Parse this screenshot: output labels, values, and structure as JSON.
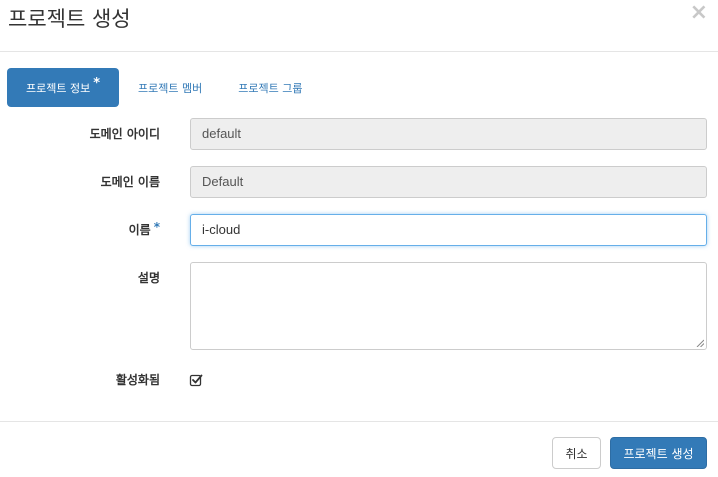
{
  "header": {
    "title": "프로젝트 생성",
    "close_glyph": "×"
  },
  "tabs": [
    {
      "label": "프로젝트 정보",
      "required_mark": "*",
      "active": true
    },
    {
      "label": "프로젝트 멤버",
      "active": false
    },
    {
      "label": "프로젝트 그룹",
      "active": false
    }
  ],
  "form": {
    "domain_id": {
      "label": "도메인 아이디",
      "value": "default"
    },
    "domain_name": {
      "label": "도메인 이름",
      "value": "Default"
    },
    "name": {
      "label": "이름",
      "required_mark": "*",
      "value": "i-cloud"
    },
    "description": {
      "label": "설명",
      "value": ""
    },
    "enabled": {
      "label": "활성화됨",
      "checked": true
    }
  },
  "footer": {
    "cancel_label": "취소",
    "submit_label": "프로젝트 생성"
  },
  "colors": {
    "primary": "#337ab7",
    "readonly_bg": "#eeeeee",
    "focus_border": "#66afe9"
  }
}
